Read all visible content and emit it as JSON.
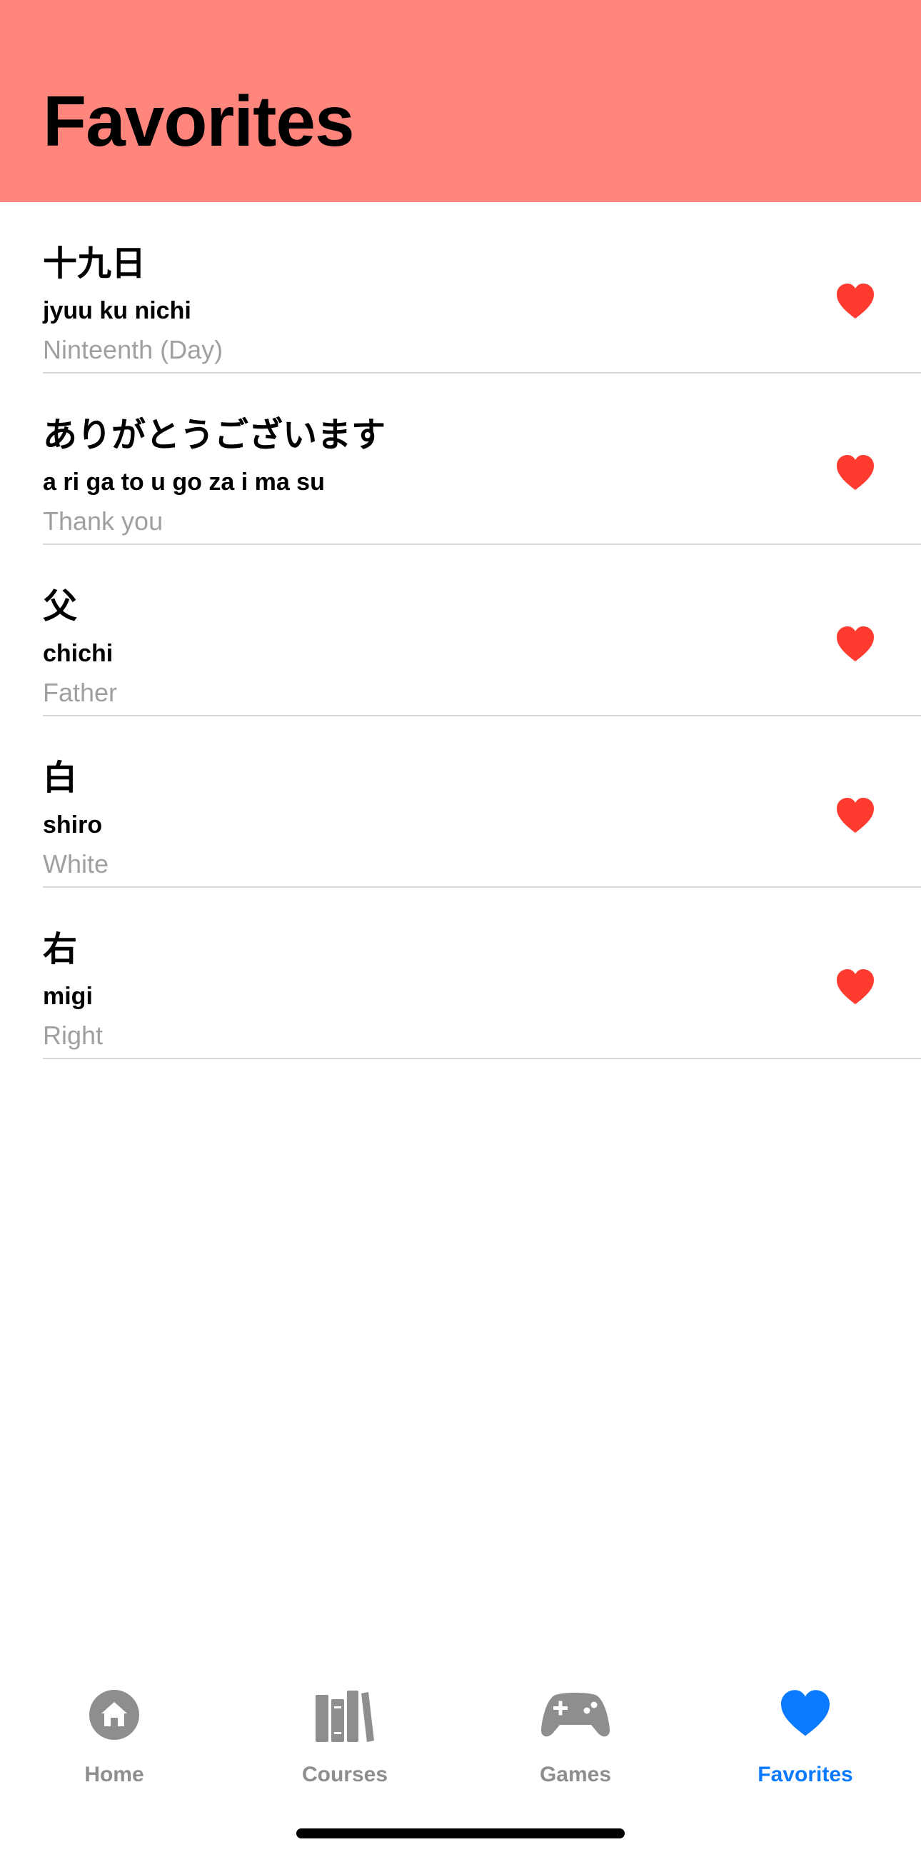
{
  "header": {
    "title": "Favorites"
  },
  "favorites": [
    {
      "kanji": "十九日",
      "romaji": "jyuu ku nichi",
      "meaning": "Ninteenth (Day)"
    },
    {
      "kanji": "ありがとうございます",
      "romaji": "a ri ga to u go za i ma su",
      "meaning": "Thank you"
    },
    {
      "kanji": "父",
      "romaji": "chichi",
      "meaning": "Father"
    },
    {
      "kanji": "白",
      "romaji": "shiro",
      "meaning": "White"
    },
    {
      "kanji": "右",
      "romaji": "migi",
      "meaning": "Right"
    }
  ],
  "tabbar": {
    "tabs": [
      {
        "label": "Home",
        "icon": "house-icon"
      },
      {
        "label": "Courses",
        "icon": "books-icon"
      },
      {
        "label": "Games",
        "icon": "gamecontroller-icon"
      },
      {
        "label": "Favorites",
        "icon": "heart-icon",
        "active": true
      }
    ]
  },
  "colors": {
    "header_bg": "#FF857D",
    "heart": "#FF3B30",
    "tab_inactive": "#8E8E8E",
    "tab_active": "#0A7AFF"
  }
}
